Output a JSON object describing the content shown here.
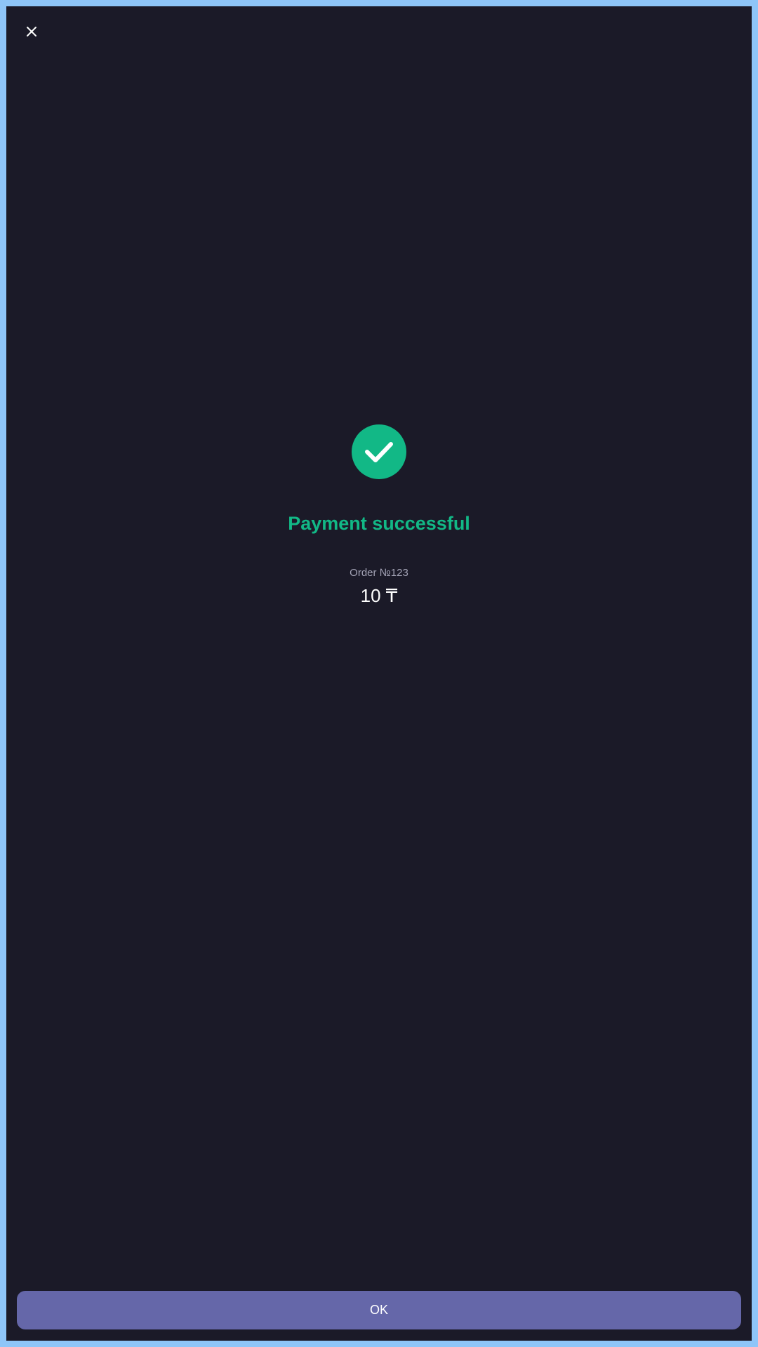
{
  "close_button": {
    "icon": "close-icon"
  },
  "success": {
    "icon": "checkmark-icon",
    "title": "Payment successful",
    "order_label": "Order №123",
    "amount": "10 ₸"
  },
  "ok_button": {
    "label": "OK"
  },
  "colors": {
    "background": "#1b1a28",
    "frame": "#8ec5f8",
    "success_green": "#12b886",
    "muted_text": "#a3a3b5",
    "primary_text": "#ffffff",
    "button_bg": "#6567a9"
  }
}
